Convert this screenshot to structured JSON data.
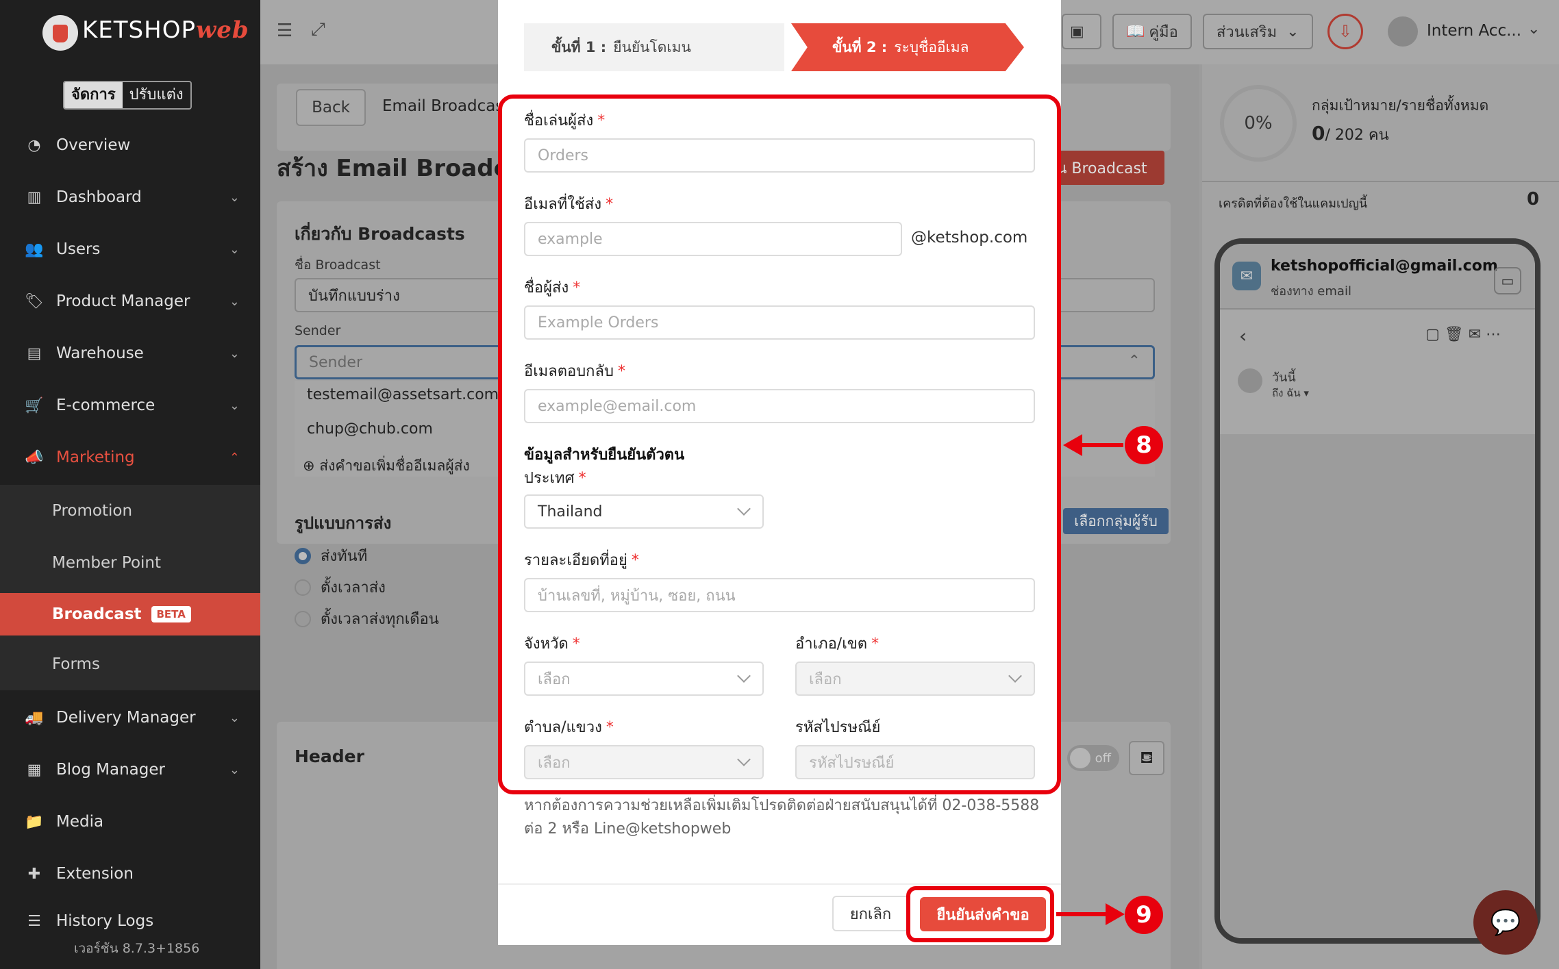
{
  "brand": {
    "name": "KETSHOP",
    "suffix": "web"
  },
  "mode": {
    "manage": "จัดการ",
    "customize": "ปรับแต่ง"
  },
  "sidebar": {
    "items": [
      {
        "label": "Overview",
        "icon": "pie-chart-icon"
      },
      {
        "label": "Dashboard",
        "icon": "bar-chart-icon"
      },
      {
        "label": "Users",
        "icon": "users-icon"
      },
      {
        "label": "Product Manager",
        "icon": "tag-icon"
      },
      {
        "label": "Warehouse",
        "icon": "warehouse-icon"
      },
      {
        "label": "E-commerce",
        "icon": "cart-icon"
      },
      {
        "label": "Marketing",
        "icon": "megaphone-icon"
      },
      {
        "label": "Delivery Manager",
        "icon": "truck-icon"
      },
      {
        "label": "Blog Manager",
        "icon": "news-icon"
      },
      {
        "label": "Media",
        "icon": "folder-icon"
      },
      {
        "label": "Extension",
        "icon": "puzzle-icon"
      },
      {
        "label": "History Logs",
        "icon": "list-icon"
      }
    ],
    "sub_items": [
      "Promotion",
      "Member Point",
      "Broadcast",
      "Forms"
    ],
    "beta": "BETA",
    "version": "เวอร์ชัน 8.7.3+1856"
  },
  "topbar": {
    "guide": "คู่มือ",
    "addons": "ส่วนเสริม",
    "user": "Intern Acc..."
  },
  "main": {
    "back": "Back",
    "breadcrumb": "Email Broadcas",
    "title": "สร้าง Email Broadc",
    "create_btn": "าน Broadcast",
    "about": "เกี่ยวกับ Broadcasts",
    "broadcast_name_label": "ชื่อ Broadcast",
    "broadcast_name_value": "บันทึกแบบร่าง",
    "sender_label": "Sender",
    "sender_placeholder": "Sender",
    "sender_options": [
      "testemail@assetsart.com",
      "chup@chub.com"
    ],
    "sender_request": "ส่งคำขอเพิ่มชื่ออีเมลผู้ส่ง",
    "send_format": "รูปแบบการส่ง",
    "send_options": [
      "ส่งทันที",
      "ตั้งเวลาส่ง",
      "ตั้งเวลาส่งทุกเดือน"
    ],
    "select_group": "เลือกกลุ่มผู้รับ",
    "header": "Header",
    "toggle": "off"
  },
  "right": {
    "percent": "0%",
    "target_label": "กลุ่มเป้าหมาย/รายชื่อทั้งหมด",
    "count": "0",
    "total": "/ 202 คน",
    "credit_label": "เครดิตที่ต้องใช้ในแคมเปญนี้",
    "credit_value": "0",
    "email": "ketshopofficial@gmail.com",
    "channel": "ช่องทาง email",
    "today": "วันนี้",
    "to_me": "ถึง ฉัน ▾"
  },
  "modal": {
    "step1_num": "ขั้นที่ 1 :",
    "step1_text": "ยืนยันโดเมน",
    "step2_num": "ขั้นที่ 2 :",
    "step2_text": "ระบุชื่ออีเมล",
    "nickname_label": "ชื่อเล่นผู้ส่ง",
    "nickname_placeholder": "Orders",
    "email_label": "อีเมลที่ใช้ส่ง",
    "email_placeholder": "example",
    "email_domain": "@ketshop.com",
    "sender_name_label": "ชื่อผู้ส่ง",
    "sender_name_placeholder": "Example Orders",
    "reply_label": "อีเมลตอบกลับ",
    "reply_placeholder": "example@email.com",
    "identity_title": "ข้อมูลสำหรับยืนยันตัวตน",
    "country_label": "ประเทศ",
    "country_value": "Thailand",
    "address_label": "รายละเอียดที่อยู่",
    "address_placeholder": "บ้านเลขที่, หมู่บ้าน, ซอย, ถนน",
    "province_label": "จังหวัด",
    "province_placeholder": "เลือก",
    "district_label": "อำเภอ/เขต",
    "district_placeholder": "เลือก",
    "subdistrict_label": "ตำบล/แขวง",
    "subdistrict_placeholder": "เลือก",
    "postcode_label": "รหัสไปรษณีย์",
    "postcode_placeholder": "รหัสไปรษณีย์",
    "help_line1": "หากต้องการความช่วยเหลือเพิ่มเติมโปรดติดต่อฝ่ายสนับสนุนได้ที่ 02-038-5588",
    "help_line2": "ต่อ 2 หรือ Line@ketshopweb",
    "cancel": "ยกเลิก",
    "confirm": "ยืนยันส่งคำขอ",
    "req": "*"
  },
  "annotations": {
    "step8": "8",
    "step9": "9"
  },
  "colors": {
    "accent": "#e74b3c",
    "highlight": "#e8000d",
    "sidebar": "#1f1f1f"
  }
}
